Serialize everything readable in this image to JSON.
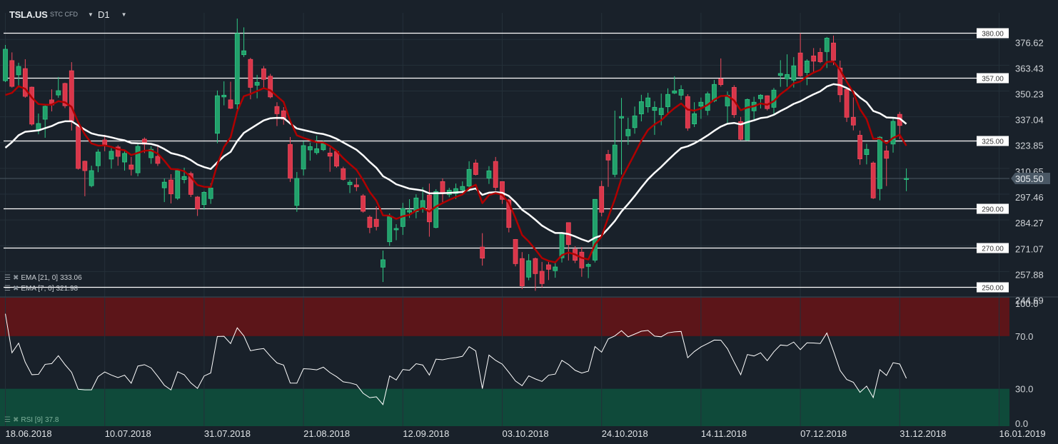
{
  "header": {
    "symbol": "TSLA.US",
    "instrument_type": "STC CFD",
    "timeframe": "D1",
    "dropdown_icon": "caret-down-icon"
  },
  "indicators": {
    "ema21": {
      "label": "EMA [21, 0]",
      "value": "333.06",
      "color": "#ffffff"
    },
    "ema7": {
      "label": "EMA [7, 0]",
      "value": "321.98",
      "color": "#b00000"
    },
    "rsi": {
      "label": "RSI [9]",
      "value": "37.8",
      "color": "#ffffff"
    },
    "icons": [
      "settings-menu-icon",
      "close-icon"
    ]
  },
  "colors": {
    "background": "#19212a",
    "grid": "#243039",
    "up": "#22a06b",
    "up_border": "#2fc986",
    "down": "#d9364a",
    "down_border": "#f04a5c",
    "level_line": "#ffffff",
    "current_price_line": "#4a5763",
    "rsi_overbought_zone": "#5c1519",
    "rsi_oversold_zone": "#0f4a3a"
  },
  "chart_data": {
    "type": "candlestick",
    "symbol": "TSLA.US",
    "timeframe": "D1",
    "ohlc_format": [
      "open",
      "high",
      "low",
      "close"
    ],
    "candles": [
      [
        355.5,
        373.8,
        354.8,
        371.6
      ],
      [
        365.8,
        370,
        352,
        352.6
      ],
      [
        358.5,
        364.7,
        353,
        362.8
      ],
      [
        361.7,
        366.5,
        346.8,
        347.5
      ],
      [
        352.2,
        352.5,
        332.5,
        333.3
      ],
      [
        330,
        338.7,
        328.1,
        333.6
      ],
      [
        335.8,
        343.5,
        326.3,
        342.4
      ],
      [
        345.7,
        351.1,
        339.8,
        343.1
      ],
      [
        348.2,
        357.4,
        346.8,
        350.4
      ],
      [
        354.1,
        354.5,
        341.5,
        342.7
      ],
      [
        360.6,
        365,
        330,
        335
      ],
      [
        332.2,
        333,
        310,
        310.6
      ],
      [
        314.3,
        314.6,
        296.4,
        309.5
      ],
      [
        301.8,
        312,
        301,
        309.5
      ],
      [
        312,
        320.4,
        308.7,
        319
      ],
      [
        325.2,
        327.8,
        319.4,
        322.7
      ],
      [
        315.4,
        321,
        310.5,
        319.4
      ],
      [
        321.6,
        322.5,
        312,
        316.8
      ],
      [
        313.9,
        319.5,
        309.5,
        318.3
      ],
      [
        312.4,
        316.5,
        307,
        310.2
      ],
      [
        308.4,
        323.8,
        306.6,
        321.9
      ],
      [
        325.6,
        326.5,
        318.5,
        323
      ],
      [
        316.1,
        322,
        313,
        320.4
      ],
      [
        316.8,
        322.8,
        311.9,
        313.2
      ],
      [
        300.7,
        305.5,
        293.4,
        303.6
      ],
      [
        304.7,
        307.7,
        292.7,
        297.6
      ],
      [
        295.4,
        310.5,
        294.5,
        309.5
      ],
      [
        304.9,
        311,
        303,
        306.5
      ],
      [
        308,
        309,
        296,
        297.3
      ],
      [
        296,
        296.5,
        286.3,
        289.9
      ],
      [
        292.1,
        299,
        289.5,
        298.4
      ],
      [
        295.2,
        303,
        292.5,
        300.6
      ],
      [
        328.6,
        350.5,
        323.5,
        347.8
      ],
      [
        347.2,
        355.2,
        342.9,
        348.1
      ],
      [
        345.7,
        355,
        341,
        341.4
      ],
      [
        343.6,
        387.3,
        340.9,
        379.7
      ],
      [
        368.8,
        382.8,
        367.6,
        370.8
      ],
      [
        366.4,
        367.2,
        346,
        352.1
      ],
      [
        353.2,
        358.5,
        346.5,
        354.7
      ],
      [
        361.6,
        363,
        352,
        356.2
      ],
      [
        357.8,
        359,
        346.5,
        347.2
      ],
      [
        342.3,
        344.5,
        332.3,
        338.6
      ],
      [
        340.1,
        342,
        333,
        335.8
      ],
      [
        322.9,
        326.7,
        303.7,
        305.7
      ],
      [
        291.7,
        308.8,
        288.4,
        305.5
      ],
      [
        310.3,
        324.5,
        307,
        322.3
      ],
      [
        320.1,
        323.8,
        314.6,
        321.8
      ],
      [
        318.7,
        327.4,
        317.7,
        320.7
      ],
      [
        320.2,
        325,
        319.5,
        323.4
      ],
      [
        318.5,
        321.3,
        308.9,
        316.9
      ],
      [
        319.3,
        320,
        311,
        311.8
      ],
      [
        310.5,
        311.5,
        304.5,
        305
      ],
      [
        302.3,
        304.8,
        298,
        303.6
      ],
      [
        302.2,
        305.8,
        299,
        301.2
      ],
      [
        296.6,
        297.5,
        288,
        288.7
      ],
      [
        285.7,
        286.6,
        277.5,
        280.4
      ],
      [
        284.6,
        291.2,
        278.9,
        280.9
      ],
      [
        260.1,
        268.6,
        252.5,
        263.9
      ],
      [
        273.1,
        287.6,
        271,
        286
      ],
      [
        279.2,
        282.1,
        273.9,
        279.9
      ],
      [
        280.9,
        293,
        276.6,
        290.1
      ],
      [
        288.3,
        294.9,
        285.3,
        289.1
      ],
      [
        288.5,
        297.4,
        285.1,
        295.5
      ],
      [
        290.3,
        301,
        288,
        294.2
      ],
      [
        297,
        302.9,
        275.7,
        283.3
      ],
      [
        280.4,
        300,
        280,
        298.8
      ],
      [
        303.9,
        305.5,
        293.3,
        298.2
      ],
      [
        297.2,
        300.7,
        295.9,
        299.5
      ],
      [
        297.8,
        302.9,
        295,
        300.3
      ],
      [
        299.6,
        304,
        297.3,
        301.4
      ],
      [
        301.6,
        314.3,
        298.7,
        310.1
      ],
      [
        313.4,
        315.2,
        307,
        307.5
      ],
      [
        270.4,
        277.5,
        260.9,
        264.7
      ],
      [
        305.7,
        311.8,
        302.7,
        309.4
      ],
      [
        314.2,
        316.5,
        299.2,
        300.9
      ],
      [
        303.9,
        304,
        292.5,
        294.8
      ],
      [
        294.5,
        295,
        277.9,
        280.4
      ],
      [
        274.3,
        274.5,
        260.5,
        261.9
      ],
      [
        264.5,
        267.8,
        248.9,
        250.5
      ],
      [
        255,
        266.8,
        253.4,
        263.4
      ],
      [
        264.5,
        265,
        248,
        256.8
      ],
      [
        258,
        262.8,
        249.7,
        251.7
      ],
      [
        261.3,
        262.8,
        253.5,
        259
      ],
      [
        258.3,
        262.3,
        254.7,
        260.2
      ],
      [
        264.9,
        278,
        262.5,
        277.3
      ],
      [
        282.9,
        283,
        263.5,
        271.7
      ],
      [
        269.3,
        270.8,
        262.2,
        263.6
      ],
      [
        267.8,
        270.4,
        255.2,
        259.7
      ],
      [
        260.5,
        262.3,
        254.5,
        261.5
      ],
      [
        263.7,
        294.9,
        262.5,
        294.8
      ],
      [
        301.4,
        304.3,
        286.1,
        288.2
      ],
      [
        317.8,
        320.1,
        301.2,
        314.9
      ],
      [
        307.6,
        340.2,
        306.1,
        322.6
      ],
      [
        336.4,
        346.7,
        307.5,
        337.2
      ],
      [
        327.3,
        336.6,
        322.7,
        330.6
      ],
      [
        331.5,
        342.3,
        328.4,
        337.5
      ],
      [
        338.5,
        348.3,
        334.7,
        344.8
      ],
      [
        342.2,
        349.3,
        339.2,
        346.7
      ],
      [
        340.3,
        345,
        327.8,
        341.9
      ],
      [
        338.1,
        348.9,
        332.7,
        341.4
      ],
      [
        342.2,
        351.6,
        338.8,
        348.5
      ],
      [
        349.2,
        357.8,
        348.7,
        350.3
      ],
      [
        348.1,
        353.2,
        345.7,
        351
      ],
      [
        347.4,
        348.6,
        329.9,
        331.3
      ],
      [
        333.4,
        344.5,
        331.8,
        338.6
      ],
      [
        342.5,
        346.9,
        336,
        344.5
      ],
      [
        340.3,
        349.9,
        337.8,
        348.8
      ],
      [
        345.2,
        355.9,
        344.5,
        353.6
      ],
      [
        356.5,
        366.9,
        352.5,
        353.5
      ],
      [
        342.6,
        350,
        333.7,
        348.1
      ],
      [
        352.1,
        353.2,
        336.5,
        338.1
      ],
      [
        334.6,
        337,
        325,
        325.5
      ],
      [
        325.2,
        346.4,
        324.7,
        345.9
      ],
      [
        340.1,
        347.3,
        335.7,
        344.5
      ],
      [
        346.3,
        348.6,
        341.3,
        348.1
      ],
      [
        347.8,
        348,
        340.3,
        341.2
      ],
      [
        341.9,
        351.8,
        338.3,
        350.7
      ],
      [
        358.2,
        366,
        352.4,
        359.2
      ],
      [
        356.5,
        369,
        352.4,
        358.7
      ],
      [
        355.8,
        367.6,
        352,
        363.1
      ],
      [
        369.7,
        379.8,
        357.5,
        358
      ],
      [
        359.7,
        366.5,
        353.2,
        365.6
      ],
      [
        368.2,
        372.2,
        360,
        365.5
      ],
      [
        370,
        372.2,
        364.5,
        365.2
      ],
      [
        370.4,
        377.9,
        362,
        377.3
      ],
      [
        374.8,
        378.6,
        363.5,
        366
      ],
      [
        362,
        365.8,
        344.5,
        348.3
      ],
      [
        351,
        351.2,
        334.4,
        336.8
      ],
      [
        336.8,
        346.9,
        330.1,
        332.8
      ],
      [
        327.6,
        330,
        312.5,
        315.5
      ],
      [
        317.7,
        323.2,
        312.7,
        320.4
      ],
      [
        313.4,
        314.2,
        295,
        295.5
      ],
      [
        300.3,
        327.1,
        294.3,
        326.6
      ],
      [
        319.6,
        322.3,
        301.6,
        315.8
      ],
      [
        323.1,
        336.9,
        318.7,
        334.7
      ],
      [
        338.3,
        339.6,
        325.6,
        332.6
      ],
      [
        305,
        310.6,
        299,
        305.5
      ]
    ],
    "ema21_start": 321.2,
    "ema7_start": 348.2,
    "current_price": 305.5,
    "current_price_label": "305.50",
    "levels": [
      {
        "value": 380,
        "label": "380.00"
      },
      {
        "value": 357,
        "label": "357.00"
      },
      {
        "value": 325,
        "label": "325.00"
      },
      {
        "value": 290,
        "label": "290.00"
      },
      {
        "value": 270,
        "label": "270.00"
      },
      {
        "value": 250,
        "label": "250.00"
      }
    ],
    "price_axis": [
      "376.62",
      "363.43",
      "350.23",
      "337.04",
      "323.85",
      "310.65",
      "297.46",
      "284.27",
      "271.07",
      "257.88",
      "244.69"
    ],
    "price_range": [
      244.69,
      380
    ],
    "rsi_axis": [
      "100.0",
      "70.0",
      "30.0",
      "0.0"
    ],
    "rsi_range": [
      0,
      100
    ],
    "rsi_zones": {
      "overbought": 70,
      "oversold": 30
    },
    "x_labels": [
      {
        "label": "18.06.2018",
        "index": 0
      },
      {
        "label": "10.07.2018",
        "index": 15
      },
      {
        "label": "31.07.2018",
        "index": 30
      },
      {
        "label": "21.08.2018",
        "index": 45
      },
      {
        "label": "12.09.2018",
        "index": 60
      },
      {
        "label": "03.10.2018",
        "index": 75
      },
      {
        "label": "24.10.2018",
        "index": 90
      },
      {
        "label": "14.11.2018",
        "index": 105
      },
      {
        "label": "07.12.2018",
        "index": 120
      },
      {
        "label": "31.12.2018",
        "index": 135
      },
      {
        "label": "16.01.2019",
        "index": 150
      }
    ],
    "grid": true
  }
}
